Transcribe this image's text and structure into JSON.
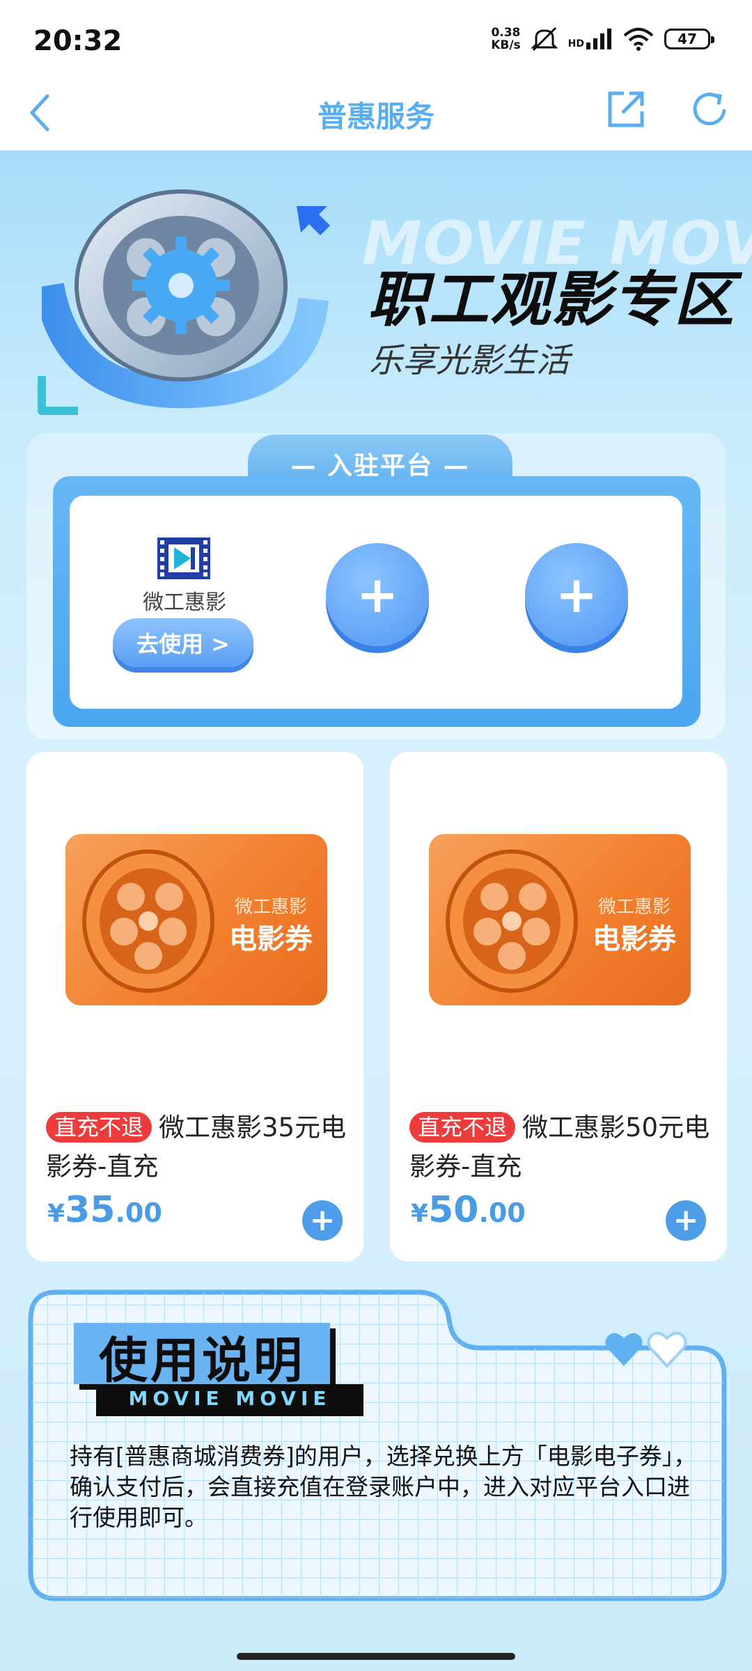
{
  "status_bar": {
    "time": "20:32",
    "net_speed_value": "0.38",
    "net_speed_unit": "KB/s",
    "hd": "HD",
    "battery": "47",
    "icons": [
      "mute-icon",
      "signal-icon",
      "wifi-icon",
      "battery-icon"
    ]
  },
  "nav": {
    "title": "普惠服务",
    "back_icon": "chevron-left-icon",
    "share_icon": "share-icon",
    "refresh_icon": "refresh-icon",
    "accent_color": "#5aaef0"
  },
  "hero": {
    "watermark": "MOVIE MOVIE",
    "title": "职工观影专区",
    "subtitle": "乐享光影生活"
  },
  "platform": {
    "tab_label": "— 入驻平台 —",
    "item": {
      "name": "微工惠影",
      "button_label": "去使用 >"
    },
    "add_slots": [
      "+",
      "+"
    ]
  },
  "products": [
    {
      "image_brand": "微工惠影",
      "image_label": "电影券",
      "tag": "直充不退",
      "title": "微工惠影35元电影券-直充",
      "price_symbol": "¥",
      "price_int": "35",
      "price_dec": ".00",
      "add_label": "+"
    },
    {
      "image_brand": "微工惠影",
      "image_label": "电影券",
      "tag": "直充不退",
      "title": "微工惠影50元电影券-直充",
      "price_symbol": "¥",
      "price_int": "50",
      "price_dec": ".00",
      "add_label": "+"
    }
  ],
  "usage": {
    "title": "使用说明",
    "subtitle": "MOVIE MOVIE",
    "text": "持有[普惠商城消费券]的用户，选择兑换上方「电影电子券」，确认支付后，会直接充值在登录账户中，进入对应平台入口进行使用即可。"
  },
  "colors": {
    "tag_red": "#ee3b3b",
    "price_blue": "#4a9be6",
    "orange": "#f27e2d"
  }
}
